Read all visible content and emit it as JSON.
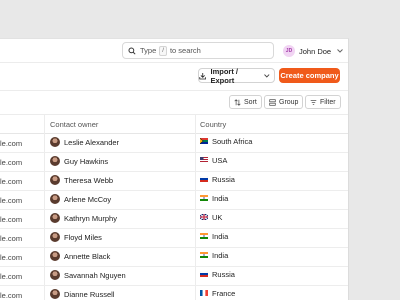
{
  "search": {
    "label_before": "Type",
    "key": "/",
    "label_after": "to search"
  },
  "user": {
    "initials": "JD",
    "name": "John Doe"
  },
  "actions": {
    "export_label": "Import / Export",
    "create_label": "Create company"
  },
  "toolbar": {
    "sort": "Sort",
    "group": "Group",
    "filter": "Filter"
  },
  "table": {
    "columns": {
      "owner": "Contact owner",
      "country": "Country"
    },
    "rows": [
      {
        "email": "le.com",
        "owner": "Leslie Alexander",
        "country": "South Africa",
        "flag": "south-africa"
      },
      {
        "email": "le.com",
        "owner": "Guy Hawkins",
        "country": "USA",
        "flag": "usa"
      },
      {
        "email": "le.com",
        "owner": "Theresa Webb",
        "country": "Russia",
        "flag": "russia"
      },
      {
        "email": "le.com",
        "owner": "Arlene McCoy",
        "country": "India",
        "flag": "india"
      },
      {
        "email": "le.com",
        "owner": "Kathryn Murphy",
        "country": "UK",
        "flag": "uk"
      },
      {
        "email": "le.com",
        "owner": "Floyd Miles",
        "country": "India",
        "flag": "india"
      },
      {
        "email": "le.com",
        "owner": "Annette Black",
        "country": "India",
        "flag": "india"
      },
      {
        "email": "le.com",
        "owner": "Savannah Nguyen",
        "country": "Russia",
        "flag": "russia"
      },
      {
        "email": "le.com",
        "owner": "Dianne Russell",
        "country": "France",
        "flag": "france"
      }
    ]
  },
  "colors": {
    "accent": "#f05a1a",
    "avatar_bg": "#f1d4f3",
    "avatar_fg": "#a23ba8"
  }
}
